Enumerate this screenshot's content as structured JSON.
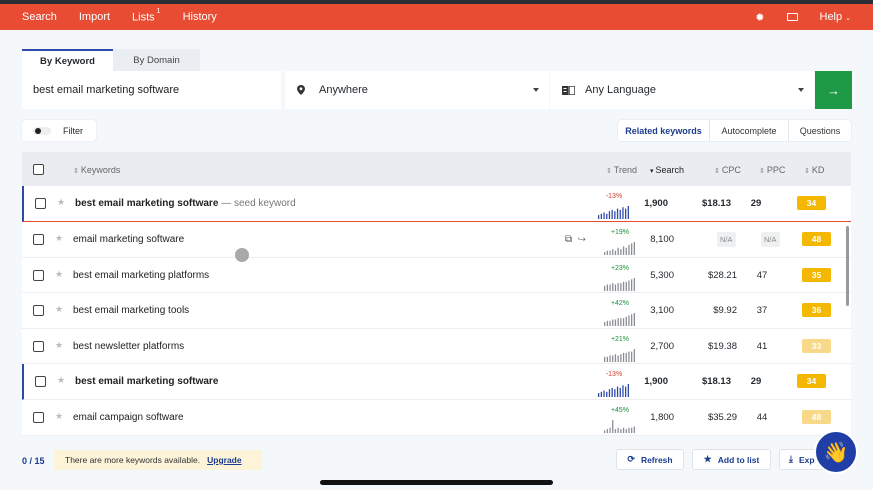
{
  "nav": {
    "items": [
      {
        "label": "Search"
      },
      {
        "label": "Import"
      },
      {
        "label": "Lists",
        "badge": "1"
      },
      {
        "label": "History"
      }
    ],
    "help_label": "Help",
    "gear_icon": "gear-icon",
    "keyboard_icon": "keyboard-icon"
  },
  "mode_tabs": [
    {
      "label": "By Keyword",
      "active": true
    },
    {
      "label": "By Domain",
      "active": false
    }
  ],
  "search": {
    "keyword_value": "best email marketing software",
    "location": "Anywhere",
    "language": "Any Language"
  },
  "filter_label": "Filter",
  "view_tabs": [
    {
      "label": "Related keywords",
      "active": true
    },
    {
      "label": "Autocomplete",
      "active": false
    },
    {
      "label": "Questions",
      "active": false
    }
  ],
  "table": {
    "headers": {
      "keywords": "Keywords",
      "trend": "Trend",
      "search": "Search",
      "cpc": "CPC",
      "ppc": "PPC",
      "kd": "KD"
    },
    "seed_tag": "— seed keyword",
    "rows": [
      {
        "keyword": "best email marketing software",
        "seed": true,
        "trend": "-13%",
        "trend_dir": "neg",
        "search": "1,900",
        "cpc": "$18.13",
        "ppc": "29",
        "kd": "34",
        "kd_color": "#f5b800",
        "spark": [
          3,
          4,
          5,
          4,
          6,
          7,
          6,
          8,
          7,
          9,
          8,
          10
        ],
        "spark_color": "#2e49a8"
      },
      {
        "keyword": "email marketing software",
        "seed": false,
        "trend": "+19%",
        "trend_dir": "pos",
        "search": "8,100",
        "cpc": "N/A",
        "ppc": "N/A",
        "kd": "48",
        "kd_color": "#f5b800",
        "spark": [
          2,
          3,
          3,
          4,
          3,
          5,
          4,
          6,
          5,
          7,
          8,
          9
        ],
        "spark_color": "#8a8f96"
      },
      {
        "keyword": "best email marketing platforms",
        "seed": false,
        "trend": "+23%",
        "trend_dir": "pos",
        "search": "5,300",
        "cpc": "$28.21",
        "ppc": "47",
        "kd": "35",
        "kd_color": "#f5b800",
        "spark": [
          4,
          5,
          5,
          6,
          5,
          6,
          6,
          7,
          7,
          8,
          9,
          10
        ],
        "spark_color": "#8a8f96"
      },
      {
        "keyword": "best email marketing tools",
        "seed": false,
        "trend": "+42%",
        "trend_dir": "pos",
        "search": "3,100",
        "cpc": "$9.92",
        "ppc": "37",
        "kd": "36",
        "kd_color": "#f5b800",
        "spark": [
          3,
          4,
          4,
          5,
          5,
          6,
          6,
          6,
          7,
          8,
          9,
          10
        ],
        "spark_color": "#8a8f96"
      },
      {
        "keyword": "best newsletter platforms",
        "seed": false,
        "trend": "+21%",
        "trend_dir": "pos",
        "search": "2,700",
        "cpc": "$19.38",
        "ppc": "41",
        "kd": "33",
        "kd_color": "#f8d98a",
        "spark": [
          4,
          4,
          5,
          5,
          6,
          5,
          6,
          7,
          7,
          8,
          8,
          10
        ],
        "spark_color": "#8a8f96"
      },
      {
        "keyword": "best email marketing software",
        "seed": true,
        "trend": "-13%",
        "trend_dir": "neg",
        "search": "1,900",
        "cpc": "$18.13",
        "ppc": "29",
        "kd": "34",
        "kd_color": "#f5b800",
        "spark": [
          3,
          4,
          5,
          4,
          6,
          7,
          6,
          8,
          7,
          9,
          8,
          10
        ],
        "spark_color": "#2e49a8"
      },
      {
        "keyword": "email campaign software",
        "seed": false,
        "trend": "+45%",
        "trend_dir": "pos",
        "search": "1,800",
        "cpc": "$35.29",
        "ppc": "44",
        "kd": "48",
        "kd_color": "#f8d98a",
        "spark": [
          2,
          3,
          4,
          10,
          3,
          4,
          3,
          4,
          3,
          4,
          4,
          5
        ],
        "spark_color": "#8a8f96"
      }
    ]
  },
  "footer": {
    "count": "0 / 15",
    "notice": "There are more keywords available.",
    "upgrade": "Upgrade",
    "refresh": "Refresh",
    "add_to_list": "Add to list",
    "export": "Exp"
  }
}
